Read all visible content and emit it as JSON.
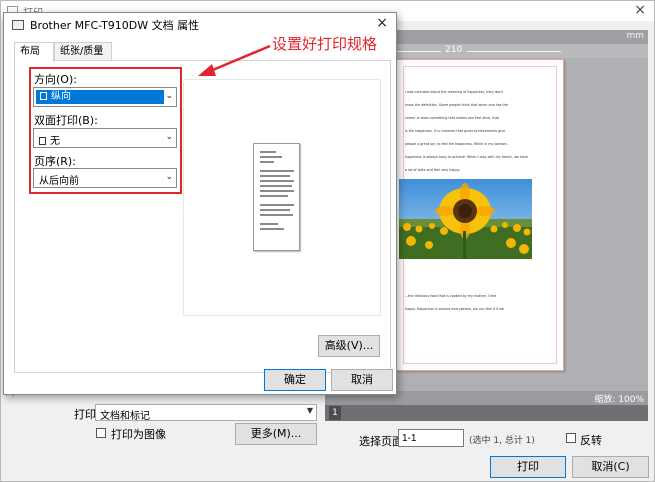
{
  "print_window": {
    "title": "打印",
    "close_glyph": "×",
    "print_label": "打印",
    "print_what": "文档和标记",
    "print_as_image": "打印为图像",
    "more_button": "更多(M)...",
    "page_select_label": "选择页面:",
    "page_select_value": "1-1",
    "page_select_hint": "(选中 1, 总计 1)",
    "reverse_label": "反转",
    "print_button": "打印",
    "cancel_button": "取消(C)",
    "left_marks": [
      "打",
      "打",
      "页",
      "高"
    ]
  },
  "preview": {
    "unit": "mm",
    "ruler_number": "210",
    "zoom": "缩放: 100%",
    "page_number": "1",
    "text_lines_top": [
      "I was confused about the meaning of happiness, they don't",
      "know the definition. Some people think that when one has the",
      "career or does something that makes one feel alive, that",
      "is the happiness. It is common that great achievements give",
      "people a great joy; to feel the happiness. While in my opinion,",
      "happiness is always easy to achieve: When I stay with my family, we have",
      "a lot of talks and feel very happy."
    ],
    "text_lines_bottom": [
      "...the delicious food that is cooked by my mother, I feel",
      "happy. Happiness is around everywhere, we can feel it if we"
    ]
  },
  "dialog": {
    "title": "Brother MFC-T910DW 文档 属性",
    "close_glyph": "×",
    "tabs": [
      {
        "label": "布局",
        "active": true
      },
      {
        "label": "纸张/质量",
        "active": false
      }
    ],
    "orientation_label": "方向(O):",
    "orientation_value": "纵向",
    "duplex_label": "双面打印(B):",
    "duplex_value": "无",
    "page_order_label": "页序(R):",
    "page_order_value": "从后向前",
    "advanced_button": "高级(V)...",
    "ok_button": "确定",
    "cancel_button": "取消"
  },
  "annotation": {
    "text": "设置好打印规格",
    "color": "#e0262e"
  },
  "colors": {
    "accent": "#0078d7",
    "annotation_red": "#e0262e"
  }
}
